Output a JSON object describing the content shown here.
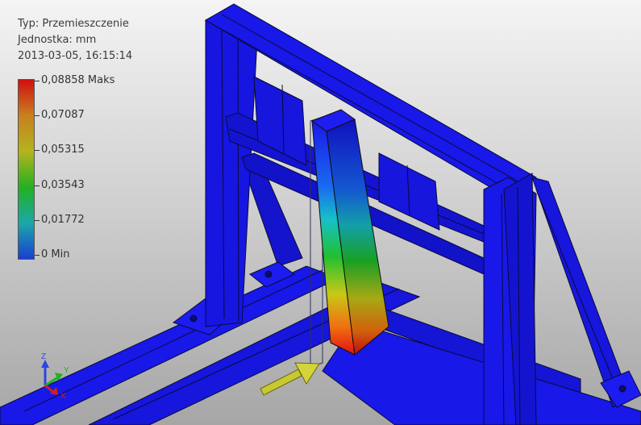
{
  "result_info": {
    "type_line": "Typ: Przemieszczenie",
    "unit_line": "Jednostka: mm",
    "timestamp": "2013-03-05, 16:15:14"
  },
  "legend": {
    "labels": [
      "0,08858 Maks",
      "0,07087",
      "0,05315",
      "0,03543",
      "0,01772",
      "0 Min"
    ],
    "colors": [
      "#d01010",
      "#c88020",
      "#b4b41c",
      "#23b023",
      "#1ba8a8",
      "#1a3ed0"
    ]
  },
  "axes_triad": {
    "z": "Z",
    "y": "Y",
    "x": "X"
  },
  "model": {
    "frame_color": "#1818e8",
    "edge_color": "#0a0a3a",
    "load_arrow_color": "#c8c832"
  }
}
